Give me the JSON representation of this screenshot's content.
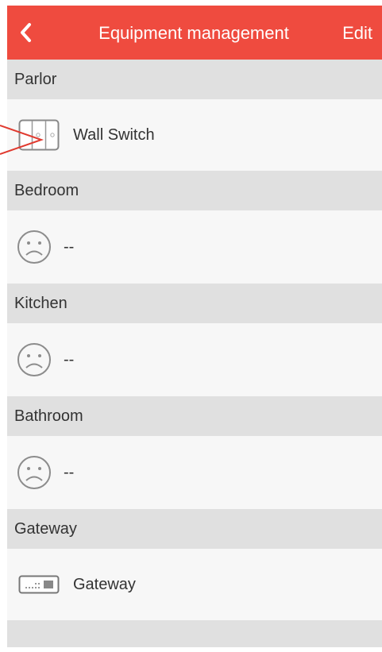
{
  "header": {
    "title": "Equipment management",
    "edit_label": "Edit",
    "back_icon": "chevron-left-icon",
    "bar_color": "#ef4b3f"
  },
  "sections": [
    {
      "name": "Parlor",
      "device": {
        "label": "Wall Switch",
        "icon": "wall-switch-icon"
      }
    },
    {
      "name": "Bedroom",
      "device": {
        "label": "--",
        "icon": "sad-face-icon"
      }
    },
    {
      "name": "Kitchen",
      "device": {
        "label": "--",
        "icon": "sad-face-icon"
      }
    },
    {
      "name": "Bathroom",
      "device": {
        "label": "--",
        "icon": "sad-face-icon"
      }
    },
    {
      "name": "Gateway",
      "device": {
        "label": "Gateway",
        "icon": "gateway-icon"
      }
    }
  ],
  "annotation": {
    "icon": "pointer-arrow-icon",
    "color": "#e03a2f"
  }
}
